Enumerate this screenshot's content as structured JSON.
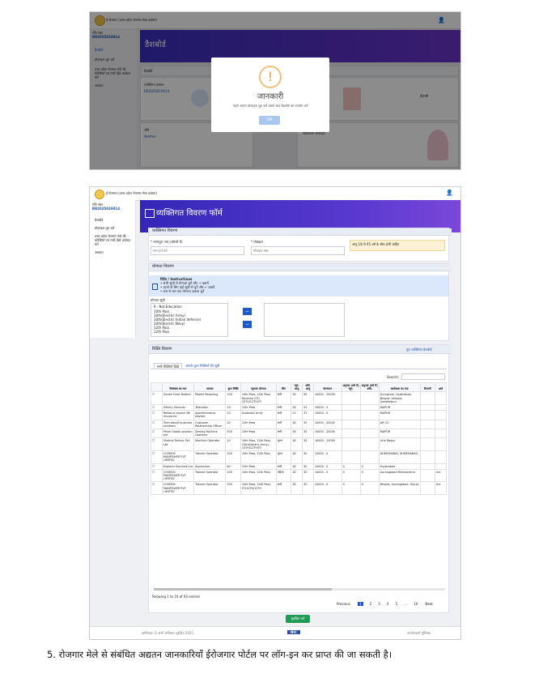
{
  "screenshot1": {
    "header_title": "ई-रोजगार (उत्तर प्रदेश रोजगार सेवा प्रबंधन)",
    "sidebar_user": "रजि नंबर",
    "sidebar_id": "RR2025010014",
    "sidebar_items": [
      "डैशबोर्ड",
      "प्रोफ़ाइल पूरा करें",
      "उत्तर प्रदेश रोजगार मेले की प्रविष्टियाँ एवं पंजी देखें आवेदन करें",
      "आवदन"
    ],
    "page_title": "डैशबोर्ड",
    "breadcrumb": "डैशबोर्ड",
    "cards": [
      {
        "title": "व्यक्तिगत प्रस्ताव",
        "value": "RR2025010014"
      },
      {
        "title": "शीर्ष",
        "value": "सेवायोजन"
      },
      {
        "title": "मैच",
        "value": "सर्वोत्तम"
      },
      {
        "title": "ईएमसी",
        "value": "ईएमसी"
      }
    ],
    "modal": {
      "icon": "!",
      "title": "जानकारी",
      "message": "पहले अपना प्रोफाइल पूरा करें उसके बाद डैशबोर्ड का उपयोग करें",
      "ok_label": "OK"
    },
    "bottom_card": "सेवायोजन प्रोफाइल"
  },
  "screenshot2": {
    "header_title": "ई-रोजगार (उत्तर प्रदेश रोजगार सेवा प्रबंधन)",
    "sidebar_user": "रजि नंबर",
    "sidebar_id": "RR2025010014",
    "sidebar_items": [
      "डैशबोर्ड",
      "प्रोफ़ाइल पूरा करें",
      "उत्तर प्रदेश रोजगार मेले की प्रविष्टियाँ एवं पंजी देखें आवेदन करें",
      "आवदन"
    ],
    "page_title": "व्यक्तिगत विवरण फॉर्म",
    "personal_section": "व्यक्तिगत विवरण",
    "name_label": "* नाम/पूरा नाम (अंग्रेजी में)",
    "name_placeholder": "नाम दर्ज करें",
    "mobile_label": "* मोबाइल",
    "mobile_placeholder": "मोबाइल नंबर",
    "notice": "आयु 18 से 45 वर्ष के बीच होनी चाहिए",
    "skill_section": "योग्यता विवरण",
    "instruction_title": "निर्देश / Instructions",
    "instruction_lines": [
      "• सभी सूची से योग्यता चुनें और → दबायें",
      "• हटाने के लिए दाईं सूची से चुनें और ← दबायें",
      "• कम से कम एक योग्यता अवश्य चुनें"
    ],
    "list_label": "योग्यता सूची",
    "list_options": [
      "8 - Not Education",
      "10th Pass",
      "10th(Electric Army)",
      "10th(Electric Indian defence)",
      "10th(Electric Navy)",
      "12th Pass",
      "12th Pass"
    ],
    "jobs_section": "रिक्ति विवरण",
    "jobs_link": "पूरा व्यक्तिगत डैशबोर्ड",
    "tabs": [
      "सभी रिक्तियाँ दिखें",
      "आपके द्वारा रिक्तियों की सूची"
    ],
    "search_label": "Search:",
    "table_headers": [
      "",
      "नियोक्ता का नाम",
      "पदनाम",
      "कुल रिक्ति",
      "न्यूनतम योग्यता",
      "लिंग",
      "न्यून. आयु",
      "अधि. आयु",
      "वेतनमान",
      "अनुभव (वर्ष में) न्यून.",
      "अनुभव (वर्ष में) अधि.",
      "कार्यस्थल का पता",
      "टिप्पणी",
      "आवे"
    ],
    "rows": [
      [
        "☐",
        "Genes Crest Biotech",
        "Mobile Repairing",
        "100",
        "10th Pass, 12th Pass, Diploma (ITI), 10TH/12TH/ITI",
        "सभी",
        "18",
        "35",
        "10000 - 25000",
        "",
        "",
        "Gurugram, Hyderabad, Bhopal, Ambala, Jamshedpur",
        "",
        ""
      ],
      [
        "☐",
        "Infinity Services",
        "Telecaller",
        "10",
        "12th Pass",
        "सभी",
        "18",
        "25",
        "10000 - 0",
        "",
        "",
        "RAIPUR",
        "",
        ""
      ],
      [
        "☐",
        "Reliance nippon life insurance",
        "Apprenticeship Advisor",
        "10",
        "Graduate Army",
        "सभी",
        "21",
        "37",
        "10000 - 0",
        "",
        "",
        "RAIPUR",
        "",
        ""
      ],
      [
        "☐",
        "Technobuilt business solutions",
        "Customer Relationship Officer",
        "20",
        "12th Pass",
        "सभी",
        "18",
        "35",
        "10000 - 20000",
        "",
        "",
        "AR CO",
        "",
        ""
      ],
      [
        "☐",
        "Prism Global solution pvt",
        "Sewing Machine Operator",
        "500",
        "10th Pass",
        "सभी",
        "18",
        "35",
        "10000 - 15000",
        "",
        "",
        "RAIPUR",
        "",
        ""
      ],
      [
        "☐",
        "Shakrai Techno Pvt. Ltd",
        "Machine Operator",
        "10",
        "10th Pass, 12th Pass, 10th(Electric Army), 10TH/12TH/ITI",
        "पुरुष",
        "18",
        "35",
        "10000 - 15000",
        "",
        "",
        "Urla Raipur",
        "",
        ""
      ],
      [
        "☐",
        "COSMOS MANPOWER PVT LIMITED",
        "Trainee Operator",
        "200",
        "10th Pass, 12th Pass",
        "पुरुष",
        "18",
        "30",
        "15000 - 0",
        "",
        "",
        "AHMEDABAD, AHMEDABAD",
        "",
        ""
      ],
      [
        "☐",
        "Explorer Services Ltd",
        "Supervisor",
        "60",
        "12th Pass",
        "सभी",
        "18",
        "30",
        "15000 - 0",
        "0",
        "0",
        "Hyderabad",
        "",
        ""
      ],
      [
        "☐",
        "COSMOS MANPOWER PVT LIMITED",
        "Trainee Operator",
        "200",
        "10th Pass, 12th Pass",
        "महिला",
        "18",
        "30",
        "14000 - 0",
        "0",
        "0",
        "Aurangabad Maharashtra",
        "",
        "Ind"
      ],
      [
        "☐",
        "COSMOS MANPOWER PVT LIMITED",
        "Trainee Operator",
        "300",
        "10th Pass, 12th Pass, ITI/10TH/12TH",
        "सभी",
        "18",
        "30",
        "15000 - 0",
        "0",
        "0",
        "Bhopal, Aurangabad, Gujrat",
        "",
        "Ind"
      ]
    ],
    "showing": "Showing 1 to 10 of 93 entries",
    "pager": [
      "Previous",
      "1",
      "2",
      "3",
      "4",
      "5",
      "…",
      "10",
      "Next"
    ],
    "submit_label": "सुरक्षित करें",
    "footer_left": "कॉपीराइट © सभी अधिकार सुरक्षित 2025",
    "footer_center": "NIC",
    "footer_right": "उपयोगकर्ता पुस्तिका"
  },
  "caption": "5.  रोजगार मेले से संबंधित अद्यतन जानकारियाँ ईरोजगार पोर्टल पर लॉग-इन कर प्राप्त की जा सकती है।"
}
